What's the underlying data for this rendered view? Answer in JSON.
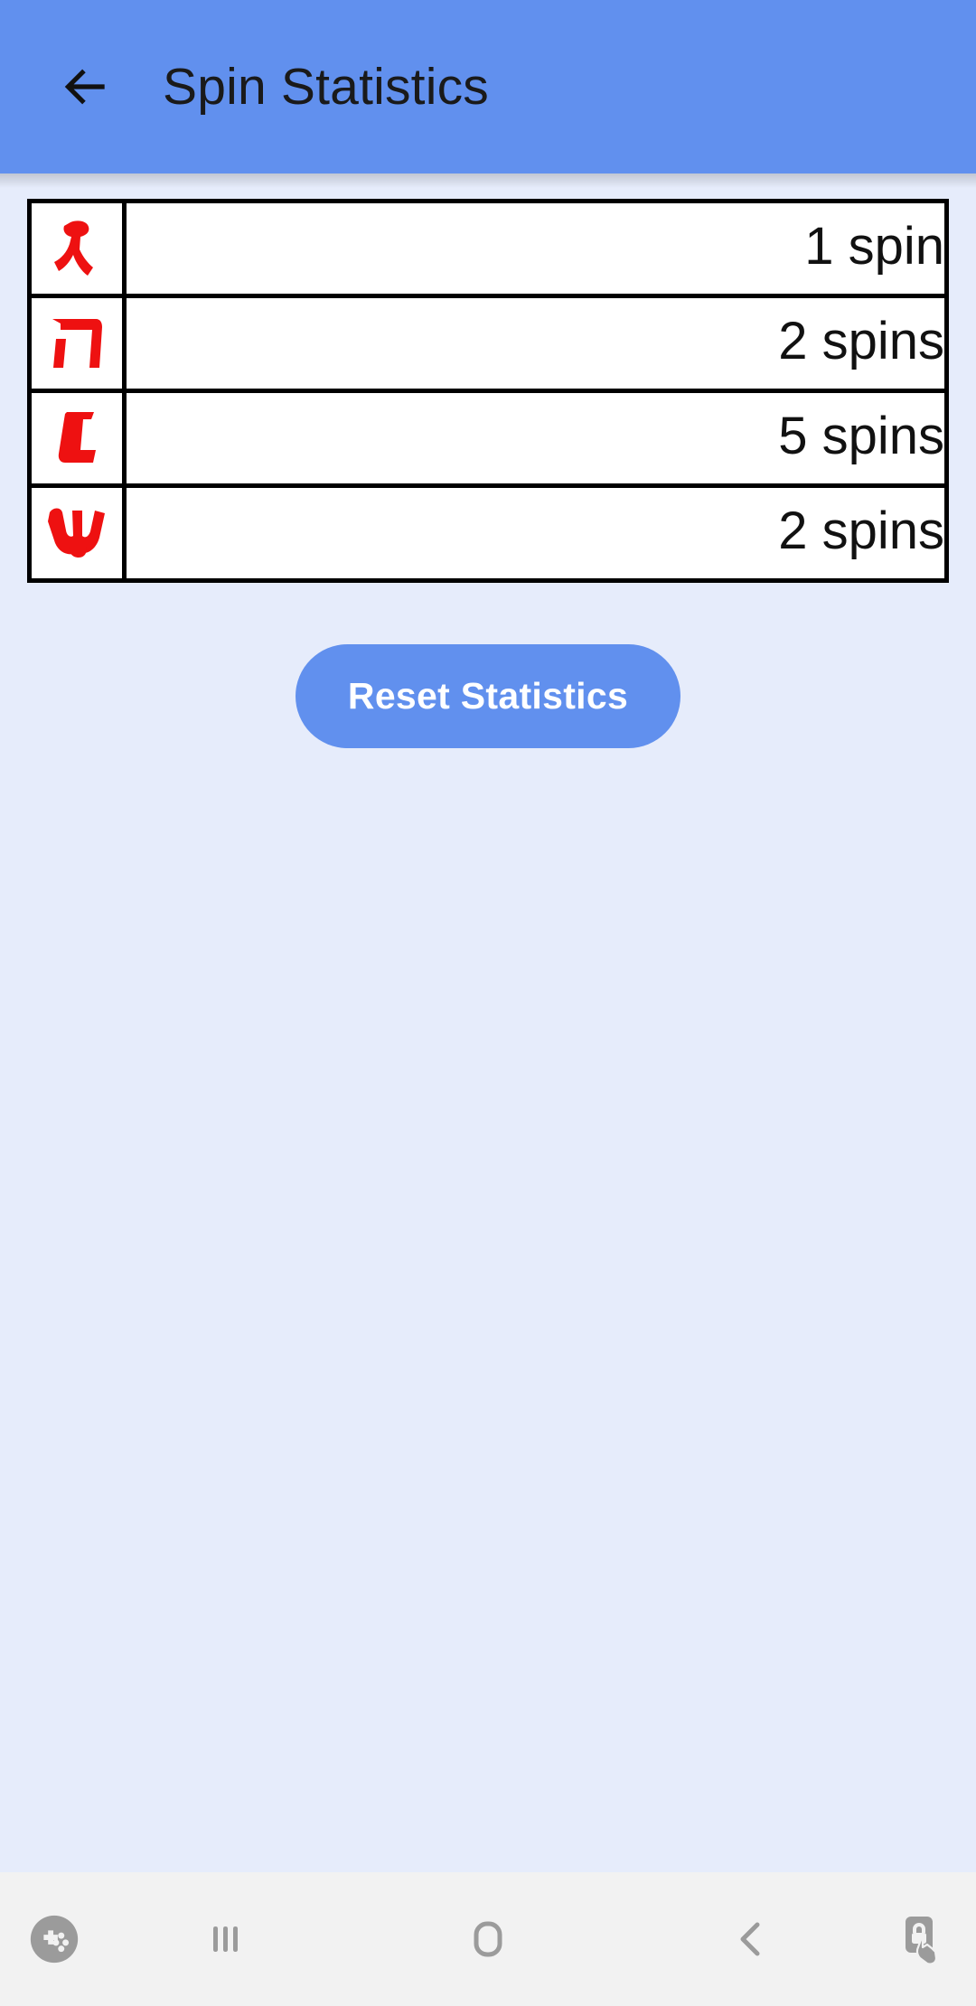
{
  "colors": {
    "header_blue": "#6190ee",
    "page_background": "#e6ecfb",
    "letter_red": "#ee1111",
    "table_border": "#000000",
    "navbar_background": "#f2f2f2",
    "nav_icon_gray": "#9b9b9b"
  },
  "appbar": {
    "title": "Spin Statistics",
    "back_icon": "arrow-left-icon"
  },
  "stats": {
    "rows": [
      {
        "letter": "ג",
        "letter_name": "gimel",
        "count_label": "1 spin",
        "count": 1
      },
      {
        "letter": "ה",
        "letter_name": "hey",
        "count_label": "2 spins",
        "count": 2
      },
      {
        "letter": "נ",
        "letter_name": "nun",
        "count_label": "5 spins",
        "count": 5
      },
      {
        "letter": "ש",
        "letter_name": "shin",
        "count_label": "2 spins",
        "count": 2
      }
    ]
  },
  "actions": {
    "reset_label": "Reset Statistics"
  },
  "navbar": {
    "items": [
      {
        "icon": "game-booster-icon"
      },
      {
        "icon": "recents-icon"
      },
      {
        "icon": "home-icon"
      },
      {
        "icon": "back-chevron-icon"
      },
      {
        "icon": "screen-pin-lock-icon"
      }
    ]
  }
}
